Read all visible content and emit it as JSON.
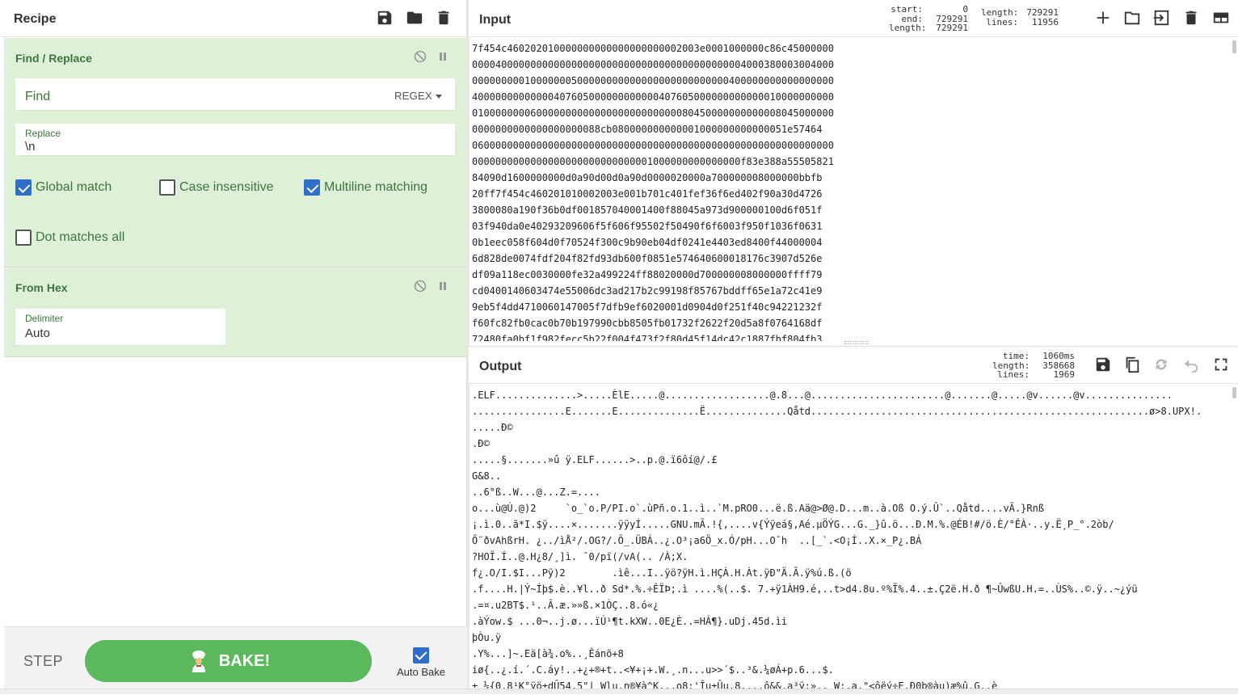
{
  "recipe": {
    "title": "Recipe",
    "operations": [
      {
        "name": "Find / Replace",
        "find": {
          "placeholder": "Find",
          "mode": "REGEX"
        },
        "replace": {
          "label": "Replace",
          "value": "\\n"
        },
        "options": [
          {
            "label": "Global match",
            "checked": true
          },
          {
            "label": "Case insensitive",
            "checked": false
          },
          {
            "label": "Multiline matching",
            "checked": true
          },
          {
            "label": "Dot matches all",
            "checked": false
          }
        ]
      },
      {
        "name": "From Hex",
        "delimiter": {
          "label": "Delimiter",
          "value": "Auto"
        }
      }
    ],
    "controls": {
      "step": "STEP",
      "bake": "BAKE!",
      "auto_bake": "Auto Bake",
      "auto_bake_checked": true
    }
  },
  "input": {
    "title": "Input",
    "stats": {
      "start_label": "start:",
      "start": "0",
      "end_label": "end:",
      "end": "729291",
      "sel_length_label": "length:",
      "sel_length": "729291",
      "length_label": "length:",
      "length": "729291",
      "lines_label": "lines:",
      "lines": "11956"
    },
    "lines": [
      "7f454c460202010000000000000000000002003e0001000000c86c45000000",
      "00004000000000000000000000000000000000000000004000380003004000",
      "00000000010000000500000000000000000000000000400000000000000000",
      "40000000000000407605000000000000407605000000000000010000000000",
      "01000000006000000000000000000000000080450000000000008045000000",
      "0000000000000000000088cb080000000000001000000000000051e57464",
      "06000000000000000000000000000000000000000000000000000000000000",
      "0000000000000000000000000000001000000000000000f83e388a55505821",
      "84090d1600000000d0a90d00d0a90d0000020000a700000008000000bbfb",
      "20ff7f454c460201010002003e001b701c401fef36f6ed402f90a30d4726",
      "3800080a190f36b0df001857040001400f88045a973d900000100d6f051f",
      "03f940da0e40293209606f5f606f95502f50490f6f6003f950f1036f0631",
      "0b1eec058f604d0f70524f300c9b90eb04df0241e4403ed8400f44000004",
      "6d828de0074fdf204f82fd93db600f0851e574640600018176c3907d526e",
      "df09a118ec0030000fe32a499224ff88020000d700000008000000ffff79",
      "cd0400140603474e55006dc3ad217b2c99198f85767bddff65e1a72c41e9",
      "9eb5f4dd4710060147005f7dfb9ef6020001d0904d0f251f40c94221232f",
      "f60fc82fb0cac0b70b197990cbb8505fb01732f2622f20d5a8f0764168df",
      "72480fa0bf1f982fecc5b22f004f473f2f80d45f14dc42c1887fbf804fb3"
    ]
  },
  "output": {
    "title": "Output",
    "stats": {
      "time_label": "time:",
      "time": "1060ms",
      "length_label": "length:",
      "length": "358668",
      "lines_label": "lines:",
      "lines": "1969"
    },
    "lines": [
      ".ELF..............>.....ÈlE.....@..................@.8...@.......................@.......@.....@v......@v...............",
      "................E.......E..............Ë..............Qåtd..........................................................ø>8.UPX!.",
      ".....Ð©",
      ".Ð©",
      ".....§.......»û ÿ.ELF......>..p.@.ï6ôí@/.£",
      "G&8..",
      "..6°ß..W...@...Z.=....",
      "o...ù@Ú.@)2     `o_`o.P/PI.o`.ùPñ.o.1..ì..`M.pRO0...ë.ß.Aä@>Ø@.D...m..à.Oß O.ý.Û`..Qåtd....vÃ.}Rnß",
      "¡.ì.0..ã*I.$ÿ....×.......ÿÿyÍ.....GNU.mÃ.!{,....v{Ýÿeá§,Aé.µÖÝG...G._}û.ö...Ð.M.%.@ÉB!#/ö.È/°ÊÀ·..y.Ë¸P_°.2òb/",
      "Õ¨ðvAhßrH. ¿../ìÅ²/.OG?/.Ô_.ÜBÁ..¿.O³¡a6Ö_x.Ó/pH...O¯h  ..[_`.<O¡Í..X.×_P¿.BÁ",
      "?HOÏ.Í..@.H¿8/¸]ì. ¯0/pï(/vA(.. /À;X.",
      "f¿.O/I.$I...Pÿ)2        .ìê...I..ÿö?ÿH.ì.HÇÀ.H.Àt.ÿÐ\"Ä.Ã.ÿ%ú.ß.(ö",
      ".f....H.|Ý~Íþ$.è..¥l..ð Sd*.%.÷ÊÏÞ;.ì ....%(..$. 7.+ÿ1ÀH9.é,..t>d4.8u.º%Ï%.4..±.Ç2ë.H.ð ¶~ÛwßU.H.=..ÙS%..©.ÿ..~¿ýü",
      ".=¤.u2BT$.¹..Ã.æ.»»ß.×1ÒÇ..8.ó«¿",
      ".àÝow.$ ...0¬..j.ø...ïÚ¹¶t.kXW..0E¿È..=HÁ¶}.uDj.45d.ìi",
      "þÒu.ÿ",
      ".Y%...]~.Eä[à¾.o%..¸Êánõ+8",
      "iø{..¿.í.´.C.áy!..+¿+®+t..<¥+¡+.W.¸.n...u>>´$..³&.¼øÁ+p.6...$.",
      "± ¼{0.8¹K°ÿö±dÛ54.5\"| Wlu.n®¥à^K...o8:'Îu±Ûu.8....ô&&.a³ÿ:».. W:.a.\"<ôëý÷E.Ð0b®àu)æ%û.G..è"
    ]
  }
}
